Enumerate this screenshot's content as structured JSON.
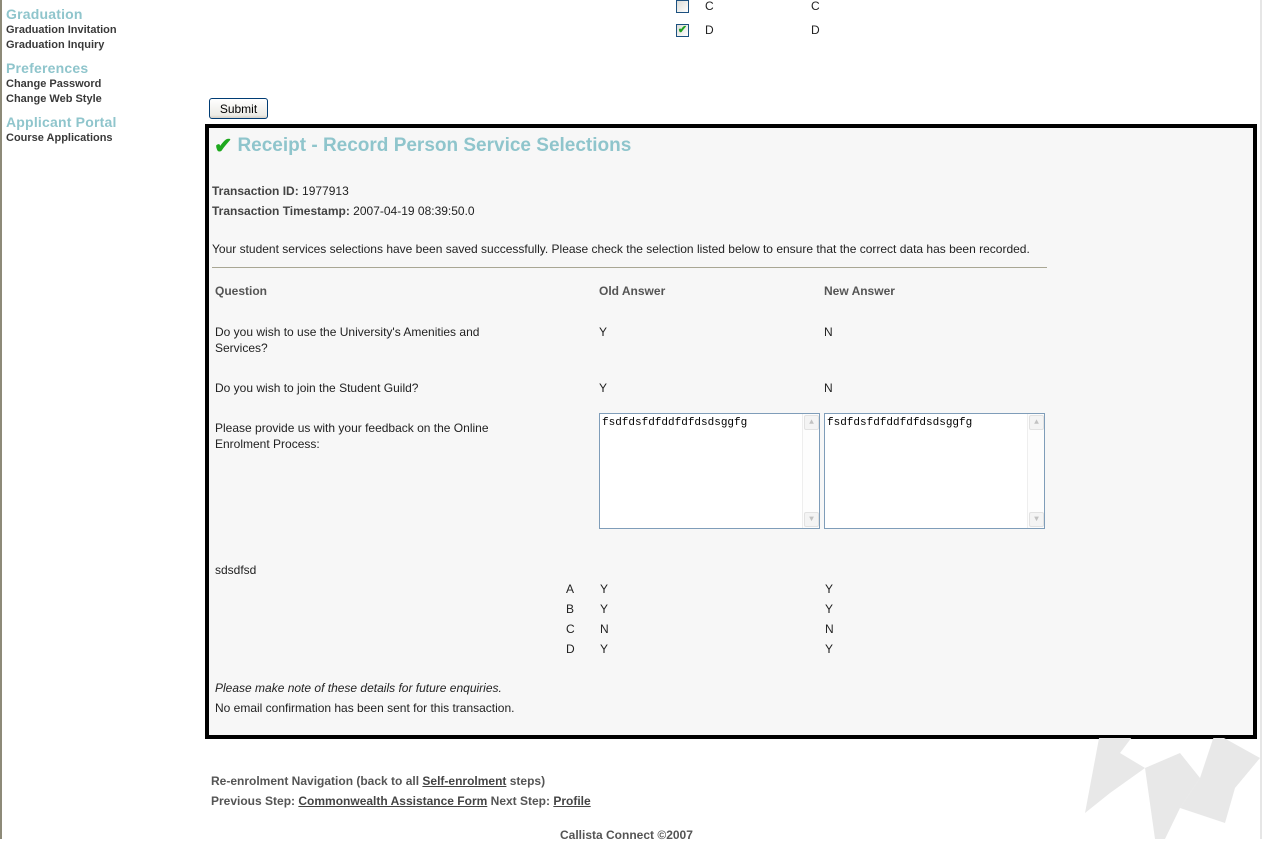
{
  "sidebar": {
    "groups": [
      {
        "heading": "Graduation",
        "items": [
          "Graduation Invitation",
          "Graduation Inquiry"
        ]
      },
      {
        "heading": "Preferences",
        "items": [
          "Change Password",
          "Change Web Style"
        ]
      },
      {
        "heading": "Applicant Portal",
        "items": [
          "Course Applications"
        ]
      }
    ]
  },
  "form_options": [
    {
      "label": "C",
      "value": "C",
      "checked": false
    },
    {
      "label": "D",
      "value": "D",
      "checked": true
    }
  ],
  "submit_label": "Submit",
  "receipt": {
    "icon": "checkmark-icon",
    "title": "Receipt - Record Person Service Selections",
    "transaction_id_label": "Transaction ID:",
    "transaction_id": "1977913",
    "timestamp_label": "Transaction Timestamp:",
    "timestamp": "2007-04-19 08:39:50.0",
    "message": "Your student services selections have been saved successfully. Please check the selection listed below to ensure that the correct data has been recorded.",
    "headers": {
      "question": "Question",
      "old": "Old Answer",
      "new": "New Answer"
    },
    "rows": [
      {
        "question": "Do you wish to use the University's Amenities and Services?",
        "old": "Y",
        "new": "N"
      },
      {
        "question": "Do you wish to join the Student Guild?",
        "old": "Y",
        "new": "N"
      },
      {
        "question": "Please provide us with your feedback on the Online Enrolment Process:",
        "old": "fsdfdsfdfddfdfdsdsggfg",
        "new": "fsdfdsfdfddfdfdsdsggfg"
      }
    ],
    "multi_question": {
      "question": "sdsdfsd",
      "options": [
        {
          "label": "A",
          "old": "Y",
          "new": "Y"
        },
        {
          "label": "B",
          "old": "Y",
          "new": "Y"
        },
        {
          "label": "C",
          "old": "N",
          "new": "N"
        },
        {
          "label": "D",
          "old": "Y",
          "new": "Y"
        }
      ]
    },
    "note": "Please make note of these details for future enquiries.",
    "email_note": "No email confirmation has been sent for this transaction."
  },
  "navigation": {
    "line1_prefix": "Re-enrolment Navigation (back to all",
    "line1_link": "Self-enrolment",
    "line1_suffix": "steps)",
    "prev_label": "Previous Step:",
    "prev_link": "Commonwealth Assistance Form",
    "next_label": "Next Step:",
    "next_link": "Profile"
  },
  "copyright": "Callista Connect ©2007"
}
